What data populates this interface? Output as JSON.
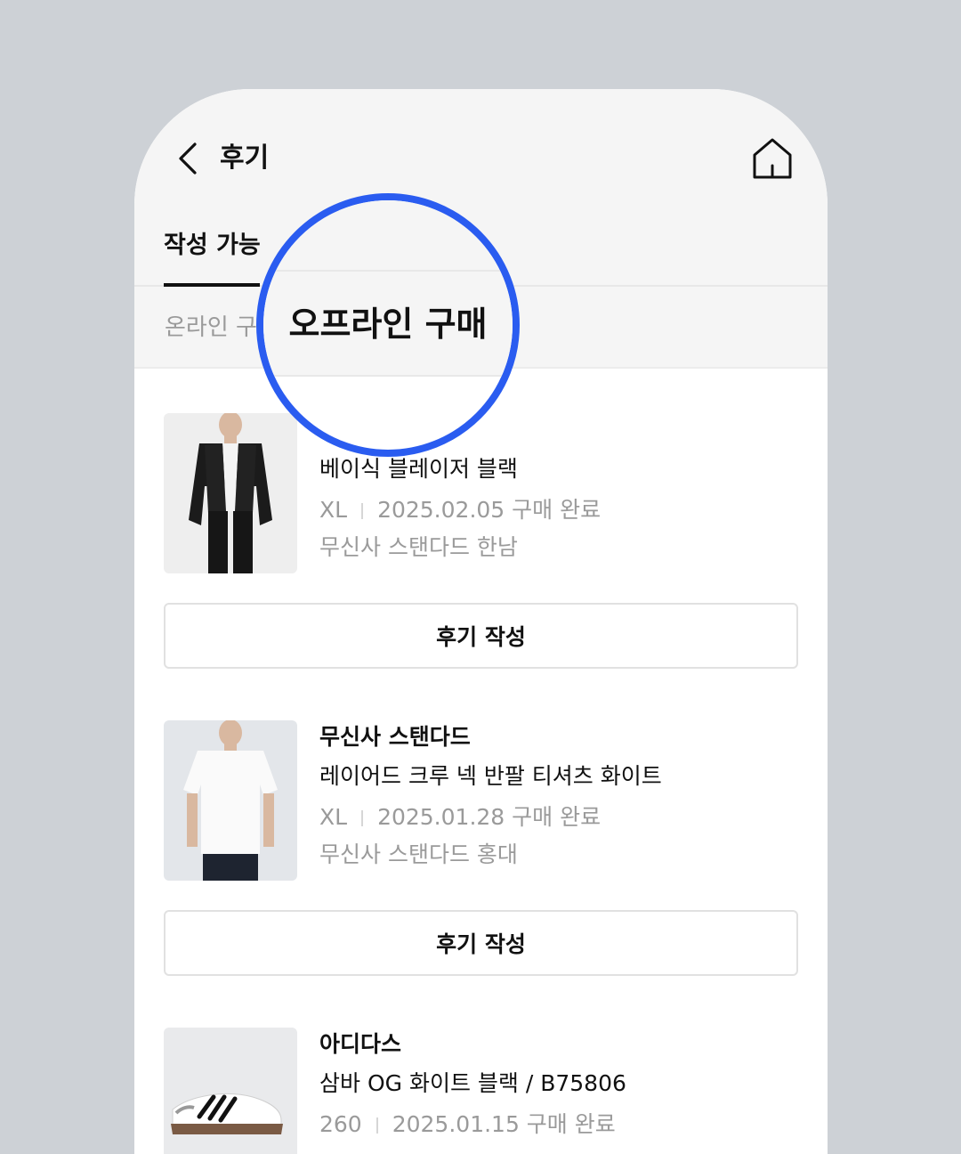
{
  "header": {
    "title": "후기",
    "back_icon": "chevron-left-icon",
    "home_icon": "home-icon"
  },
  "tabs": {
    "active_label": "작성 가능"
  },
  "subtabs": {
    "online_label_partial": "온라인 구",
    "magnified_label": "오프라인 구매"
  },
  "items": [
    {
      "brand": "",
      "name": "베이식 블레이저 블랙",
      "size": "XL",
      "date_status": "2025.02.05 구매 완료",
      "store": "무신사 스탠다드 한남",
      "button_label": "후기 작성"
    },
    {
      "brand": "무신사 스탠다드",
      "name": "레이어드 크루 넥 반팔 티셔츠 화이트",
      "size": "XL",
      "date_status": "2025.01.28 구매 완료",
      "store": "무신사 스탠다드 홍대",
      "button_label": "후기 작성"
    },
    {
      "brand": "아디다스",
      "name": "삼바 OG 화이트 블랙 / B75806",
      "size": "260",
      "date_status": "2025.01.15 구매 완료",
      "store": "",
      "button_label": ""
    }
  ],
  "colors": {
    "background": "#cdd1d6",
    "accent_ring": "#2a5cf0",
    "muted_text": "#9a9a9a"
  }
}
